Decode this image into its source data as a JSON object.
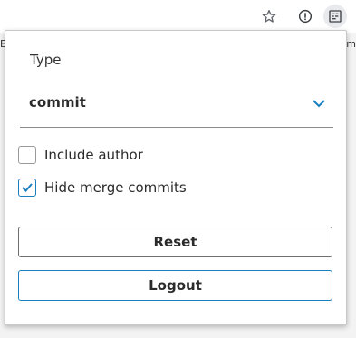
{
  "browser": {
    "icons": {
      "bookmark": "star-icon",
      "info": "info-icon",
      "extension": "extension-icon"
    },
    "left_edge_text": "E",
    "right_edge_text": "Sm"
  },
  "popup": {
    "type_label": "Type",
    "type_select": {
      "value": "commit"
    },
    "options": [
      {
        "label": "Include author",
        "checked": false
      },
      {
        "label": "Hide merge commits",
        "checked": true
      }
    ],
    "reset_label": "Reset",
    "logout_label": "Logout"
  },
  "colors": {
    "accent": "#1a7fbf",
    "border_gray": "#6e6e6e"
  }
}
